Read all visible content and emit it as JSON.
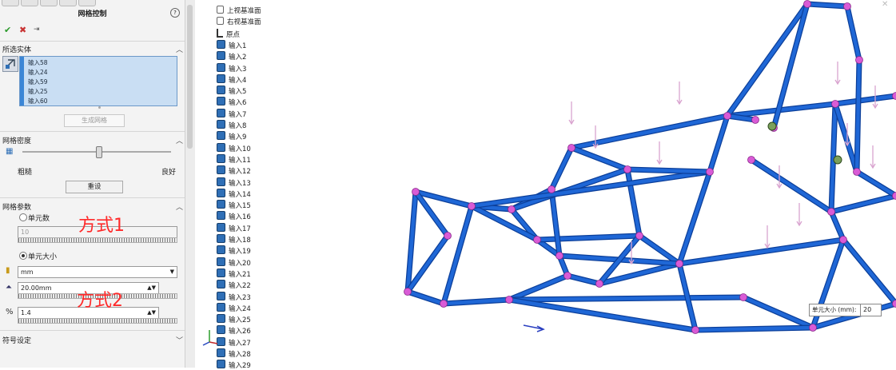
{
  "property_manager": {
    "title": "网格控制",
    "help_icon": "?",
    "ok_icon": "✔",
    "cancel_icon": "✖",
    "pin_icon": "⇥",
    "selected_bodies": {
      "header": "所选实体",
      "items": [
        "输入58",
        "输入24",
        "输入59",
        "输入25",
        "输入60"
      ],
      "generate_button": "生成网格"
    },
    "mesh_density": {
      "header": "网格密度",
      "coarse_label": "粗糙",
      "fine_label": "良好",
      "slider_level": 0.5,
      "reset_button": "重设"
    },
    "mesh_params": {
      "header": "网格参数",
      "option_element_count": "单元数",
      "element_count_value": "10",
      "option_element_size": "单元大小",
      "unit_value": "mm",
      "size_value": "20.00mm",
      "ratio_value": "1.4"
    },
    "symbol_settings": {
      "header": "符号设定"
    },
    "annotation_1": "方式1",
    "annotation_2": "方式2"
  },
  "feature_tree": {
    "planes": [
      "上视基准面",
      "右视基准面"
    ],
    "origin": "原点",
    "items": [
      "输入1",
      "输入2",
      "输入3",
      "输入4",
      "输入5",
      "输入6",
      "输入7",
      "输入8",
      "输入9",
      "输入10",
      "输入11",
      "输入12",
      "输入13",
      "输入14",
      "输入15",
      "输入16",
      "输入17",
      "输入18",
      "输入19",
      "输入20",
      "输入21",
      "输入22",
      "输入23",
      "输入24",
      "输入25",
      "输入26",
      "输入27",
      "输入28",
      "输入29"
    ]
  },
  "graphics": {
    "tooltip_label": "单元大小 (mm):",
    "tooltip_value": "20",
    "colors": {
      "tube": "#1f67d6",
      "tube_dark": "#0c3f9a",
      "node": "#d95bd6",
      "load_arrow": "#d9a3cf"
    }
  }
}
